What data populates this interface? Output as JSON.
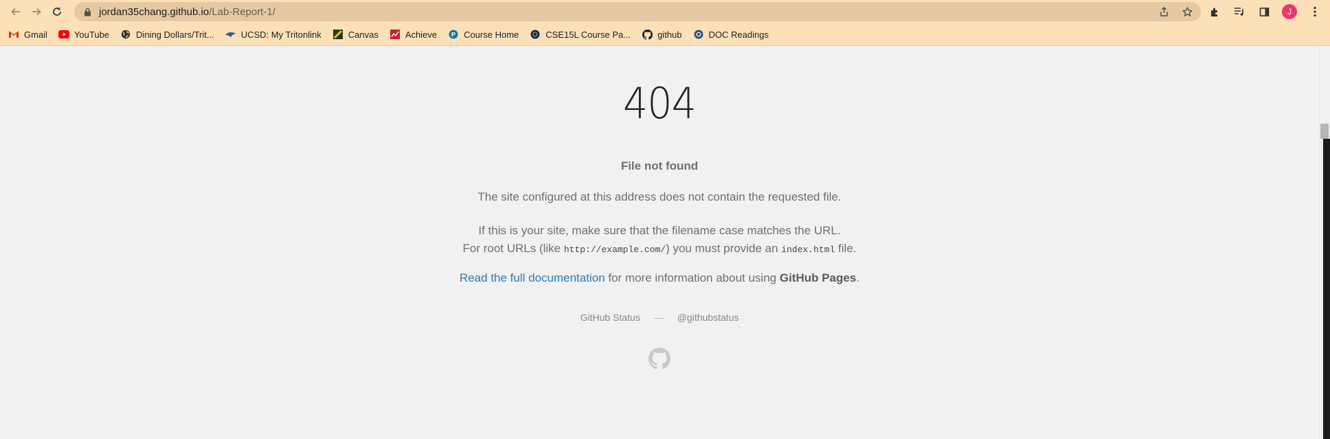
{
  "browser": {
    "url_host": "jordan35chang.github.io",
    "url_path": "/Lab-Report-1/",
    "avatar_letter": "J",
    "avatar_color": "#e8396a"
  },
  "bookmarks": [
    {
      "label": "Gmail",
      "icon": "gmail-icon"
    },
    {
      "label": "YouTube",
      "icon": "youtube-icon"
    },
    {
      "label": "Dining Dollars/Trit...",
      "icon": "globe-icon"
    },
    {
      "label": "UCSD: My Tritonlink",
      "icon": "triton-icon"
    },
    {
      "label": "Canvas",
      "icon": "canvas-icon"
    },
    {
      "label": "Achieve",
      "icon": "achieve-icon"
    },
    {
      "label": "Course Home",
      "icon": "pearson-icon"
    },
    {
      "label": "CSE15L Course Pa...",
      "icon": "cse-icon"
    },
    {
      "label": "github",
      "icon": "github-icon"
    },
    {
      "label": "DOC Readings",
      "icon": "doc-icon"
    }
  ],
  "page": {
    "code": "404",
    "title": "File not found",
    "p1": "The site configured at this address does not contain the requested file.",
    "p2_line1": "If this is your site, make sure that the filename case matches the URL.",
    "p2_line2_a": "For root URLs (like ",
    "p2_code1": "http://example.com/",
    "p2_line2_b": ") you must provide an ",
    "p2_code2": "index.html",
    "p2_line2_c": " file.",
    "p3_link": "Read the full documentation",
    "p3_mid": " for more information about using ",
    "p3_bold": "GitHub Pages",
    "p3_end": ".",
    "footer_status": "GitHub Status",
    "footer_sep": "—",
    "footer_twitter": "@githubstatus",
    "link_color": "#2a7ab8"
  }
}
